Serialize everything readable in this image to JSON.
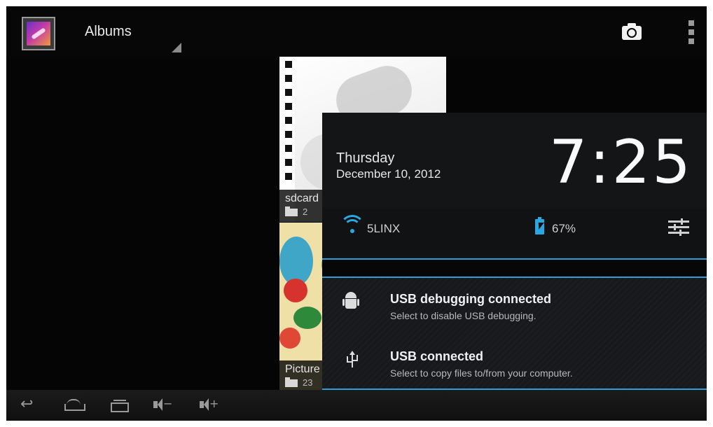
{
  "action_bar": {
    "title": "Albums",
    "camera_icon": "camera-icon",
    "overflow_icon": "overflow-menu-icon"
  },
  "albums": [
    {
      "name": "sdcard",
      "count": "2"
    },
    {
      "name": "Picture",
      "count": "23"
    }
  ],
  "notification_shade": {
    "day": "Thursday",
    "date": "December 10, 2012",
    "time": "7:25",
    "wifi_name": "5LINX",
    "battery_percent": "67%",
    "notifications": [
      {
        "title": "USB debugging connected",
        "text": "Select to disable USB debugging.",
        "icon": "android-debug-icon"
      },
      {
        "title": "USB connected",
        "text": "Select to copy files to/from your computer.",
        "icon": "usb-icon"
      }
    ]
  },
  "colors": {
    "accent": "#2b9fd6",
    "background": "#050505",
    "panel": "#111315"
  }
}
